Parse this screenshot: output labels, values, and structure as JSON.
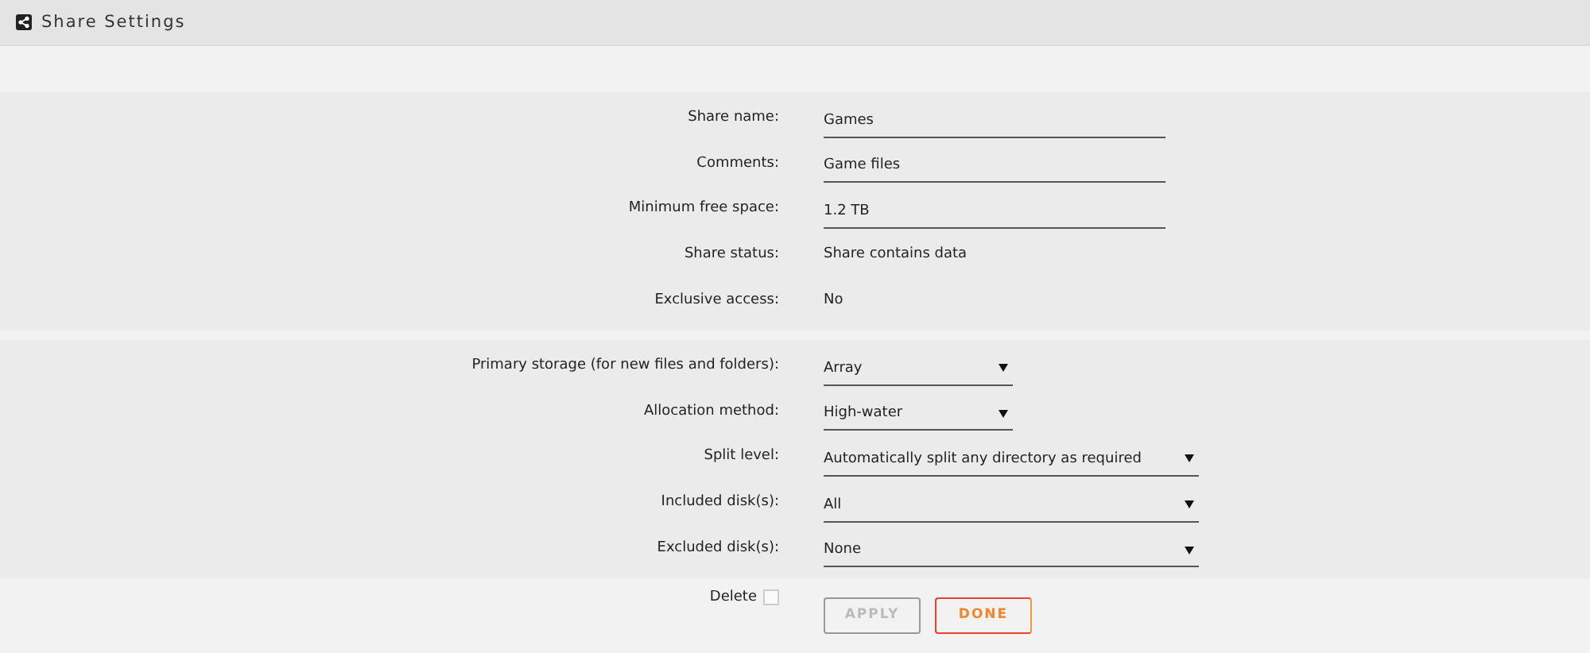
{
  "header": {
    "title": "Share Settings"
  },
  "sections": [
    {
      "rows": [
        {
          "label": "Share name:",
          "kind": "input",
          "value": "Games"
        },
        {
          "label": "Comments:",
          "kind": "input",
          "value": "Game files"
        },
        {
          "label": "Minimum free space:",
          "kind": "input",
          "value": "1.2 TB"
        },
        {
          "label": "Share status:",
          "kind": "text",
          "value": "Share contains data"
        },
        {
          "label": "Exclusive access:",
          "kind": "text",
          "value": "No"
        }
      ]
    },
    {
      "rows": [
        {
          "label": "Primary storage (for new files and folders):",
          "kind": "select",
          "wide": false,
          "value": "Array"
        },
        {
          "label": "Allocation method:",
          "kind": "select",
          "wide": false,
          "value": "High-water"
        },
        {
          "label": "Split level:",
          "kind": "select",
          "wide": true,
          "value": "Automatically split any directory as required"
        },
        {
          "label": "Included disk(s):",
          "kind": "select",
          "wide": true,
          "value": "All"
        },
        {
          "label": "Excluded disk(s):",
          "kind": "select",
          "wide": true,
          "value": "None"
        }
      ]
    }
  ],
  "footer": {
    "delete": {
      "label": "Delete",
      "checked": false
    },
    "buttons": [
      {
        "label": "APPLY",
        "kind": "apply",
        "disabled": true
      },
      {
        "label": "DONE",
        "kind": "done",
        "disabled": false
      }
    ]
  }
}
